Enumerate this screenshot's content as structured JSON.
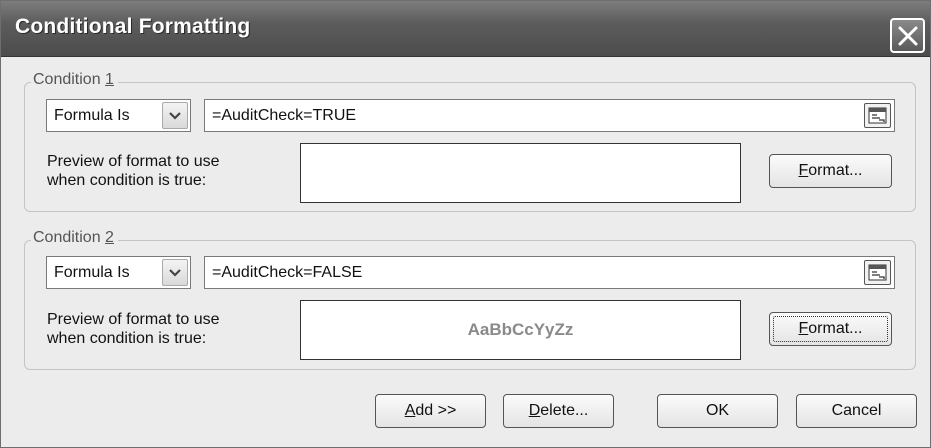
{
  "window": {
    "title": "Conditional Formatting"
  },
  "conditions": [
    {
      "label_prefix": "Condition ",
      "label_accel": "1",
      "type_value": "Formula Is",
      "formula_value": "=AuditCheck=TRUE",
      "preview_label_line1": "Preview of format to use",
      "preview_label_line2": "when condition is true:",
      "preview_sample": "",
      "format_accel": "F",
      "format_rest": "ormat..."
    },
    {
      "label_prefix": "Condition ",
      "label_accel": "2",
      "type_value": "Formula Is",
      "formula_value": "=AuditCheck=FALSE",
      "preview_label_line1": "Preview of format to use",
      "preview_label_line2": "when condition is true:",
      "preview_sample": "AaBbCcYyZz",
      "format_accel": "F",
      "format_rest": "ormat..."
    }
  ],
  "footer": {
    "add_accel": "A",
    "add_rest": "dd >>",
    "delete_accel": "D",
    "delete_rest": "elete...",
    "ok_label": "OK",
    "cancel_label": "Cancel"
  },
  "icons": {
    "close": "close-x-icon",
    "dropdown": "chevron-down-icon",
    "range_picker": "collapse-dialog-icon"
  }
}
